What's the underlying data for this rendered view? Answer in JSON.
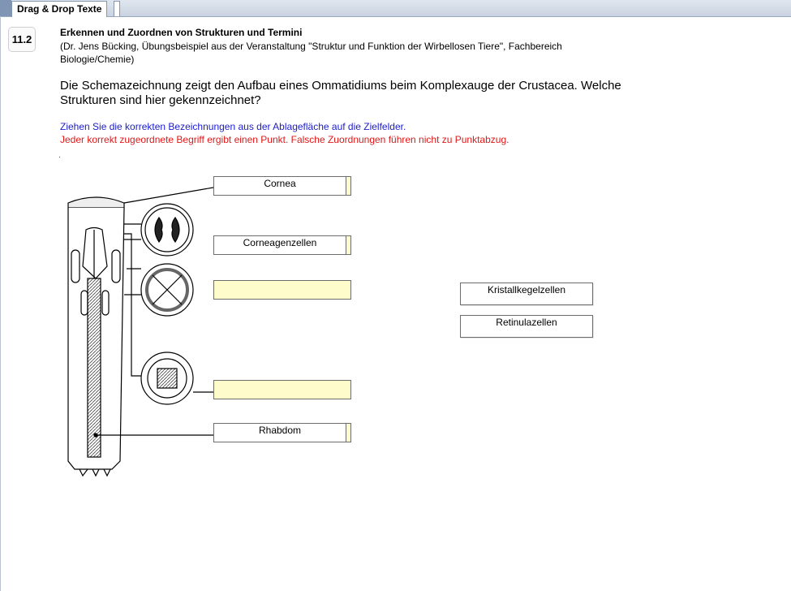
{
  "tab": {
    "label": "Drag & Drop Texte"
  },
  "question": {
    "number": "11.2",
    "title": "Erkennen und Zuordnen von Strukturen und Termini",
    "subtitle": "(Dr. Jens Bücking, Übungsbeispiel aus der Veranstaltung \"Struktur und Funktion der Wirbellosen Tiere\", Fachbereich Biologie/Chemie)",
    "text": "Die Schemazeichnung zeigt den Aufbau eines Ommatidiums beim Komplexauge der Crustacea. Welche Strukturen sind hier gekennzeichnet?",
    "instruction": "Ziehen Sie die korrekten Bezeichnungen aus der Ablagefläche auf die Zielfelder.",
    "scoring_note": "Jeder korrekt zugeordnete Begriff ergibt einen Punkt. Falsche Zuordnungen führen nicht zu Punktabzug."
  },
  "drop_zones": [
    {
      "value": "Cornea",
      "filled": true
    },
    {
      "value": "Corneagenzellen",
      "filled": true
    },
    {
      "value": "",
      "filled": false
    },
    {
      "value": "",
      "filled": false
    },
    {
      "value": "Rhabdom",
      "filled": true
    }
  ],
  "source_items": [
    "Kristallkegelzellen",
    "Retinulazellen"
  ],
  "colors": {
    "instruction": "#1c1ccc",
    "scoring_note": "#e01818",
    "empty_zone": "#fffccc"
  }
}
